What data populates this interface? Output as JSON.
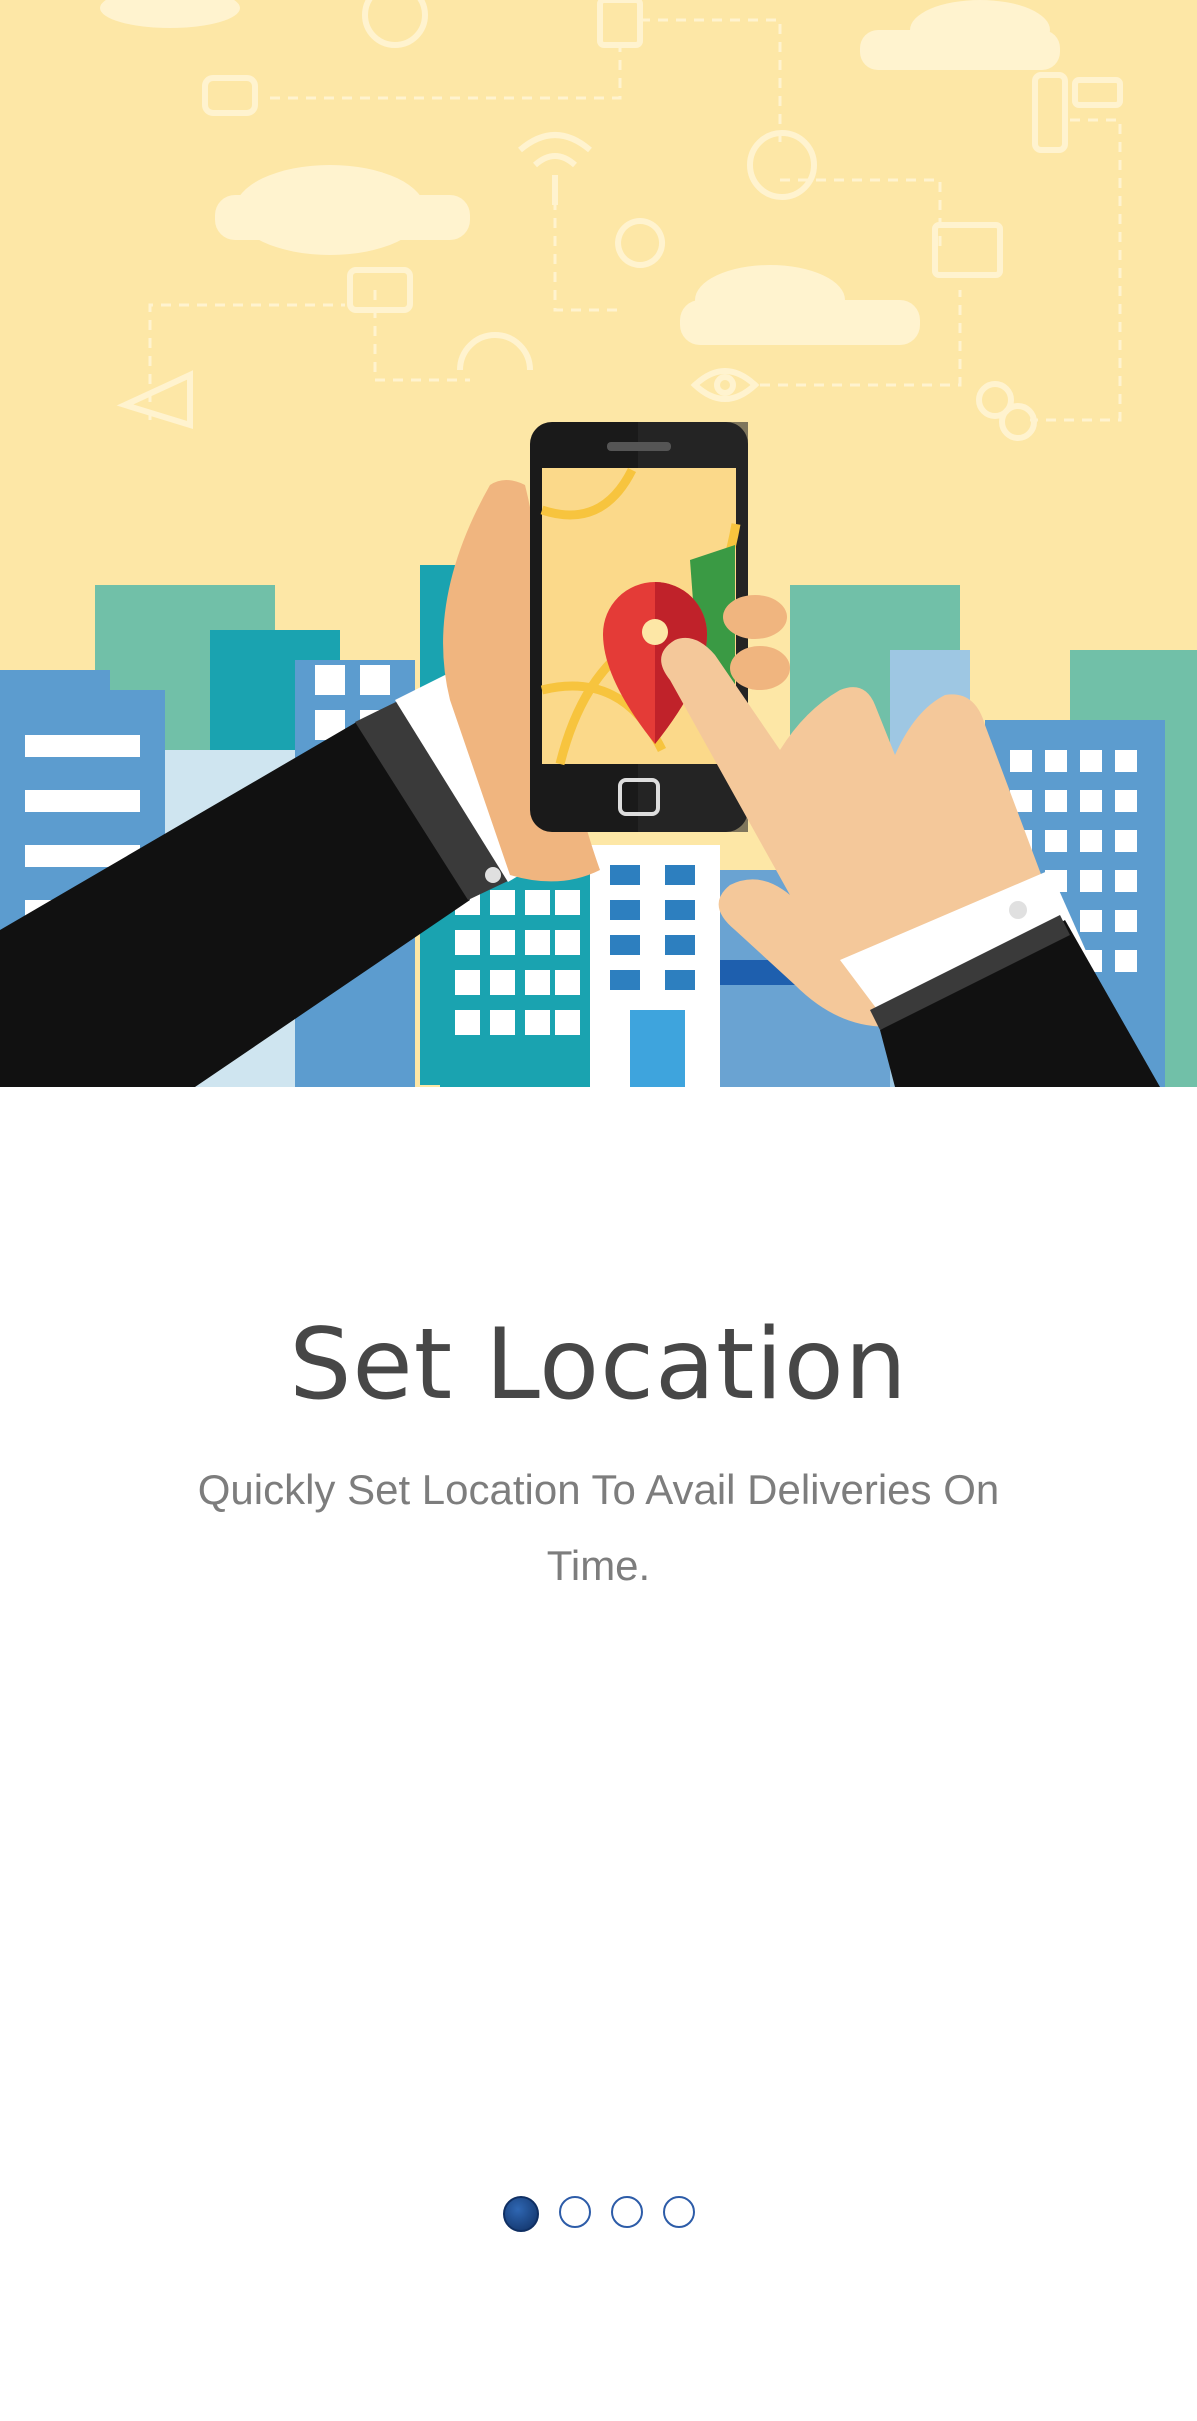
{
  "onboarding": {
    "title": "Set Location",
    "subtitle": "Quickly Set Location To Avail Deliveries On Time.",
    "illustration": "hands-holding-phone-with-map-pin-city",
    "pagination": {
      "total": 4,
      "current": 1
    }
  },
  "colors": {
    "hero_background": "#fde7a6",
    "title": "#474747",
    "subtitle": "#7d7d7d",
    "dot_active": "#0f2f63",
    "dot_border": "#2d5ca8"
  }
}
